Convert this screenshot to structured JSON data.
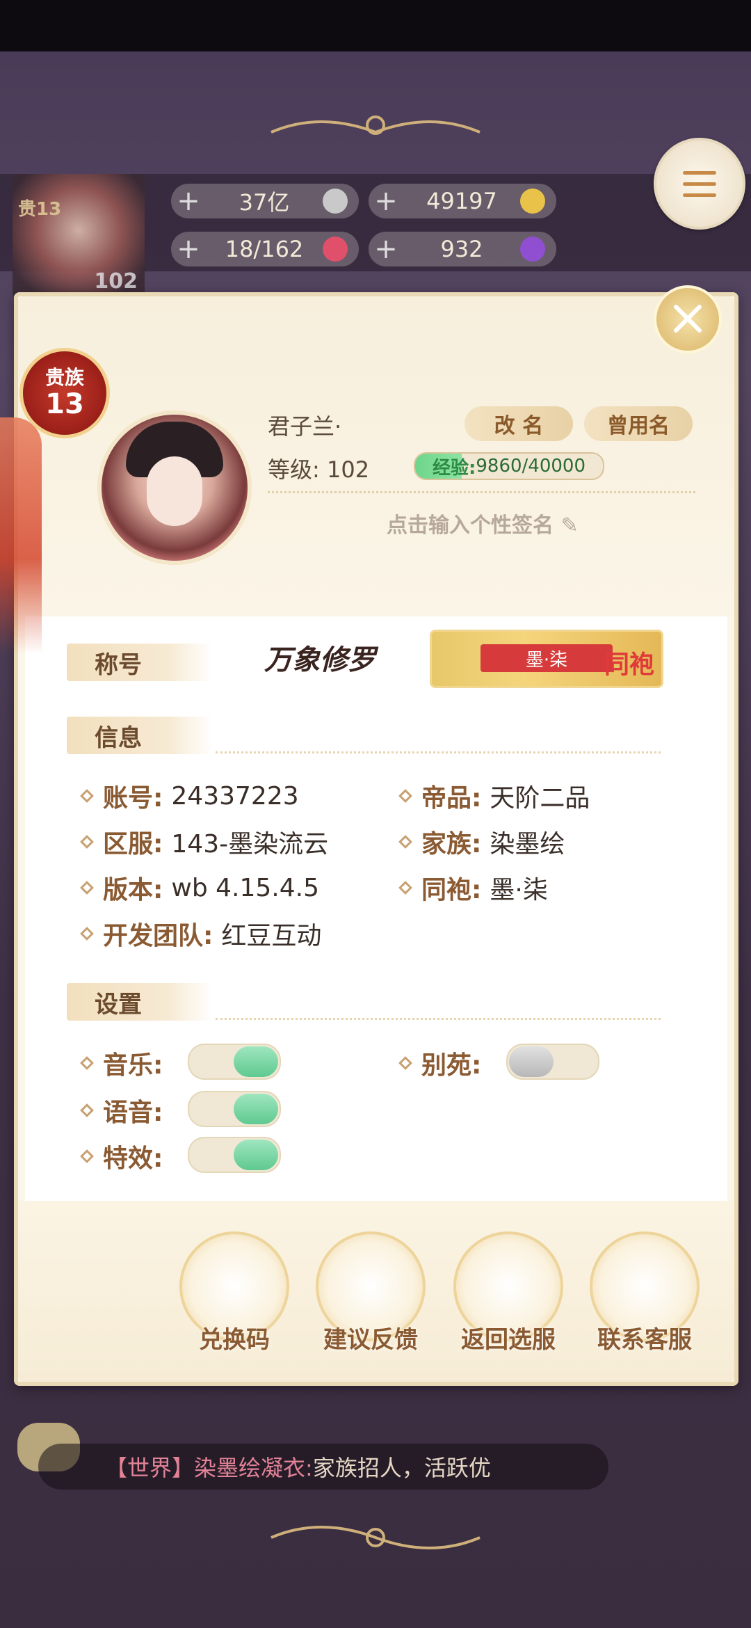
{
  "top_hud": {
    "vip_label": "贵13",
    "player_level": "102",
    "resources": [
      {
        "value": "37亿",
        "icon": "silver-coin-icon"
      },
      {
        "value": "49197",
        "icon": "gold-ingot-icon"
      },
      {
        "value": "18/162",
        "icon": "heart-icon"
      },
      {
        "value": "932",
        "icon": "purple-gem-icon"
      }
    ]
  },
  "profile": {
    "noble_title": "贵族",
    "noble_level": "13",
    "name": "君子兰·",
    "rename_button": "改 名",
    "old_names_button": "曾用名",
    "level_label": "等级:",
    "level_value": "102",
    "exp_label": "经验:",
    "exp_value": "9860/40000",
    "exp_progress": 0.2465,
    "signature_placeholder": "点击输入个性签名"
  },
  "titles": {
    "header": "称号",
    "title_1": "万象修罗",
    "title_2_text": "墨·柒",
    "title_2_tag": "同袍"
  },
  "info": {
    "header": "信息",
    "rows": [
      {
        "key": "账号:",
        "value": "24337223"
      },
      {
        "key": "帝品:",
        "value": "天阶二品"
      },
      {
        "key": "区服:",
        "value": "143-墨染流云"
      },
      {
        "key": "家族:",
        "value": "染墨绘"
      },
      {
        "key": "版本:",
        "value": "wb 4.15.4.5"
      },
      {
        "key": "同袍:",
        "value": "墨·柒"
      },
      {
        "key": "开发团队:",
        "value": "红豆互动"
      }
    ]
  },
  "settings": {
    "header": "设置",
    "music": {
      "label": "音乐:",
      "on": true
    },
    "voice": {
      "label": "语音:",
      "on": true
    },
    "effects": {
      "label": "特效:",
      "on": true
    },
    "garden": {
      "label": "别苑:",
      "on": false
    }
  },
  "actions": [
    {
      "label": "兑换码",
      "icon": "gift-box-icon"
    },
    {
      "label": "建议反馈",
      "icon": "feedback-character-icon"
    },
    {
      "label": "返回选服",
      "icon": "return-server-icon"
    },
    {
      "label": "联系客服",
      "icon": "customer-service-icon"
    }
  ],
  "chat": {
    "channel": "【世界】",
    "speaker": "染墨绘凝衣:",
    "message": "家族招人，活跃优"
  },
  "colors": {
    "toggle_on": "#5fc990",
    "toggle_off": "#b7b7b7",
    "accent_brown": "#8a5a32",
    "noble_red": "#9a1f19"
  }
}
